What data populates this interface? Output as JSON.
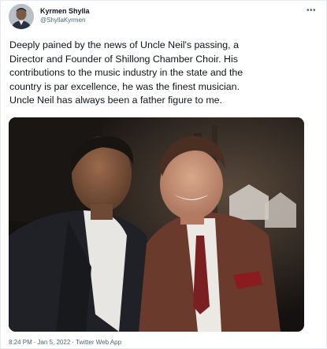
{
  "tweet": {
    "author": {
      "display_name": "Kyrmen Shylla",
      "handle": "@ShyllaKyrmen"
    },
    "more_icon": "more-horizontal-icon",
    "text_lines": [
      "Deeply pained by the news of Uncle Neil's passing, a",
      "Director and Founder of Shillong Chamber Choir. His",
      "contributions to the music industry in the state and the",
      "country is par excellence, he was the finest musician.",
      "Uncle Neil has always been a father figure to me."
    ],
    "meta": {
      "time": "8:24 PM",
      "date": "Jan 5, 2022",
      "separator": "·",
      "source": "Twitter Web App"
    }
  }
}
